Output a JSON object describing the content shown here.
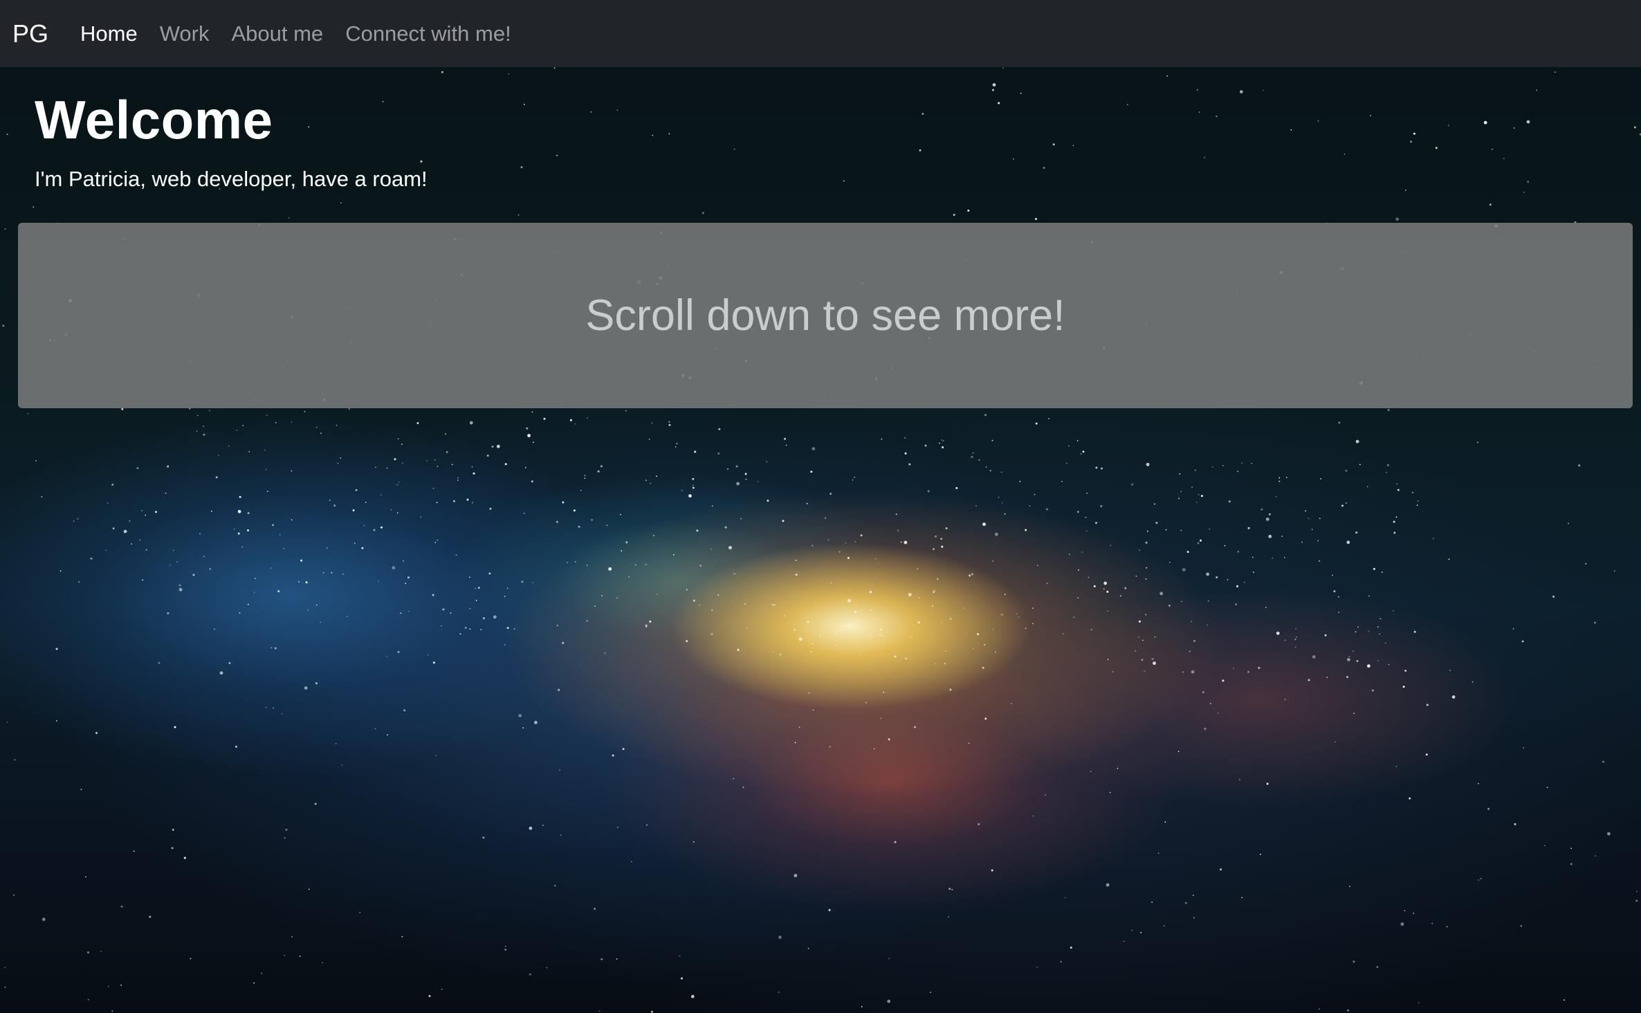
{
  "navbar": {
    "brand": "PG",
    "links": [
      {
        "label": "Home",
        "active": true
      },
      {
        "label": "Work",
        "active": false
      },
      {
        "label": "About me",
        "active": false
      },
      {
        "label": "Connect with me!",
        "active": false
      }
    ]
  },
  "hero": {
    "title": "Welcome",
    "subtitle": "I'm Patricia, web developer, have a roam!"
  },
  "scroll_panel": {
    "text": "Scroll down to see more!"
  },
  "colors": {
    "navbar_bg": "#212529",
    "panel_bg": "#787a7a",
    "panel_text": "#c9cdd0"
  }
}
